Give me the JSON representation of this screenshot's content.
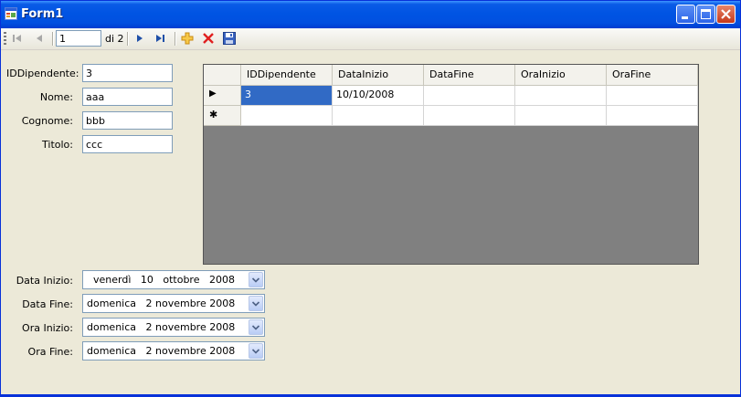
{
  "window": {
    "title": "Form1"
  },
  "navigator": {
    "position": "1",
    "count_label": "di 2"
  },
  "form": {
    "labels": [
      "IDDipendente:",
      "Nome:",
      "Cognome:",
      "Titolo:"
    ],
    "values": [
      "3",
      "aaa",
      "bbb",
      "ccc"
    ]
  },
  "grid": {
    "columns": [
      "IDDipendente",
      "DataInizio",
      "DataFine",
      "OraInizio",
      "OraFine"
    ],
    "rows": [
      [
        "3",
        "10/10/2008",
        "",
        "",
        ""
      ]
    ],
    "current_row_marker": "▶",
    "new_row_marker": "✱"
  },
  "pickers": {
    "labels": [
      "Data Inizio:",
      "Data Fine:",
      "Ora Inizio:",
      "Ora Fine:"
    ],
    "values": [
      "  venerdì   10   ottobre   2008",
      "domenica   2 novembre 2008",
      "domenica   2 novembre 2008",
      "domenica   2 novembre 2008"
    ]
  },
  "icons": {
    "first": "move-first-icon",
    "previous": "move-previous-icon",
    "next": "move-next-icon",
    "last": "move-last-icon",
    "add": "add-new-icon",
    "delete": "delete-icon",
    "save": "save-icon"
  },
  "colors": {
    "titlebar": "#0054E3",
    "selection": "#316AC5",
    "grid_background": "#808080",
    "form_background": "#ECE9D8"
  }
}
